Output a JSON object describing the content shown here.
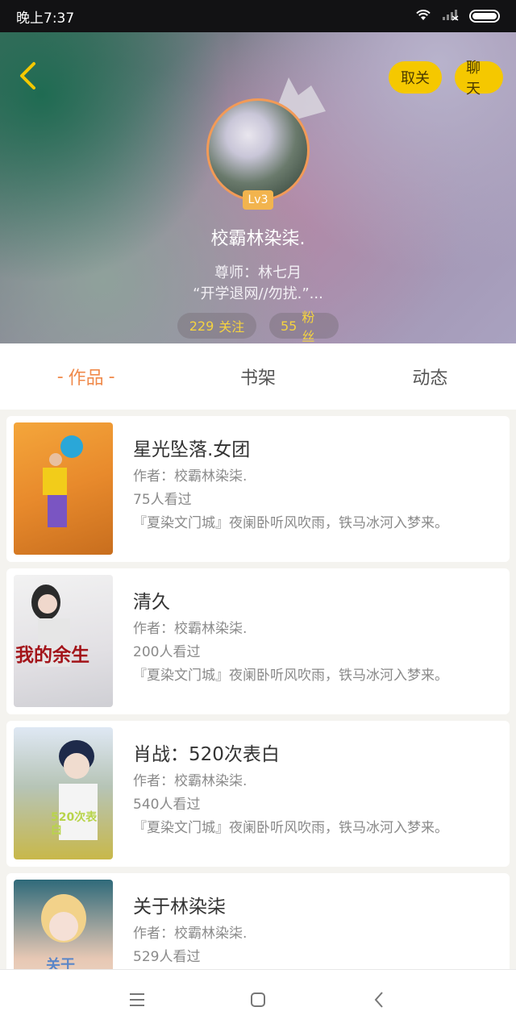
{
  "status_bar": {
    "time": "晚上7:37",
    "icons": [
      "wifi-icon",
      "signal-icon",
      "battery-icon"
    ]
  },
  "header": {
    "back_icon": "chevron-left-icon",
    "unfollow_label": "取关",
    "chat_label": "聊天",
    "accent_color": "#f5c800"
  },
  "profile": {
    "level": "Lv3",
    "username": "校霸林染柒.",
    "mentor": "尊师：林七月",
    "bio": "“开学退网//勿扰.”...",
    "following_count": "229",
    "following_label": "关注",
    "fans_count": "55",
    "fans_label": "粉丝"
  },
  "tabs": [
    {
      "label": "作品",
      "active": true
    },
    {
      "label": "书架",
      "active": false
    },
    {
      "label": "动态",
      "active": false
    }
  ],
  "works": [
    {
      "title": "星光坠落.女团",
      "author": "作者：校霸林染柒.",
      "views": "75人看过",
      "desc": "『夏染文门城』夜阑卧听风吹雨，铁马冰河入梦来。"
    },
    {
      "title": "清久",
      "author": "作者：校霸林染柒.",
      "views": "200人看过",
      "desc": "『夏染文门城』夜阑卧听风吹雨，铁马冰河入梦来。",
      "cover_text": "我的余生"
    },
    {
      "title": "肖战：520次表白",
      "author": "作者：校霸林染柒.",
      "views": "540人看过",
      "desc": "『夏染文门城』夜阑卧听风吹雨，铁马冰河入梦来。",
      "cover_text": "520次表白"
    },
    {
      "title": "关于林染柒",
      "author": "作者：校霸林染柒.",
      "views": "529人看过",
      "desc": "",
      "cover_text": "关于"
    }
  ],
  "nav": [
    "menu-icon",
    "home-square-icon",
    "back-chevron-icon"
  ]
}
